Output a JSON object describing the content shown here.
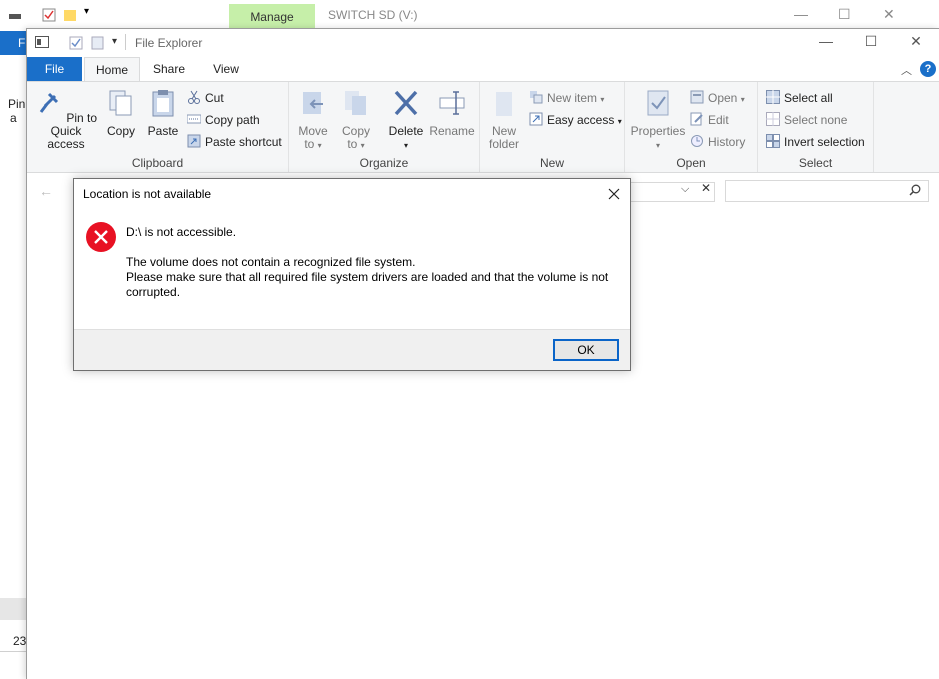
{
  "background_window": {
    "manage_tab": "Manage",
    "title": "SWITCH SD (V:)",
    "file_tab": "F",
    "left_text": "Pin",
    "left_text_2": "a",
    "left_count": "23"
  },
  "window": {
    "title": "File Explorer",
    "help_label": "?"
  },
  "tabs": [
    "File",
    "Home",
    "Share",
    "View"
  ],
  "ribbon": {
    "clipboard": {
      "label": "Clipboard",
      "pin_line1": "Pin to Quick",
      "pin_line2": "access",
      "copy": "Copy",
      "paste": "Paste",
      "cut": "Cut",
      "copy_path": "Copy path",
      "paste_shortcut": "Paste shortcut"
    },
    "organize": {
      "label": "Organize",
      "move_line1": "Move",
      "move_line2": "to",
      "copy_line1": "Copy",
      "copy_line2": "to",
      "delete": "Delete",
      "rename": "Rename"
    },
    "new": {
      "label": "New",
      "new_folder_line1": "New",
      "new_folder_line2": "folder",
      "new_item": "New item",
      "easy_access": "Easy access"
    },
    "open": {
      "label": "Open",
      "properties": "Properties",
      "open": "Open",
      "edit": "Edit",
      "history": "History"
    },
    "select": {
      "label": "Select",
      "select_all": "Select all",
      "select_none": "Select none",
      "invert_selection": "Invert selection"
    }
  },
  "dialog": {
    "title": "Location is not available",
    "main": "D:\\ is not accessible.",
    "line1": "The volume does not contain a recognized file system.",
    "line2": "Please make sure that all required file system drivers are loaded and that the volume is not corrupted.",
    "ok": "OK"
  },
  "colors": {
    "accent": "#1a6fc9",
    "manage_tab": "#c6efa9",
    "error_red": "#e81123",
    "dialog_footer": "#f0f0f0"
  }
}
